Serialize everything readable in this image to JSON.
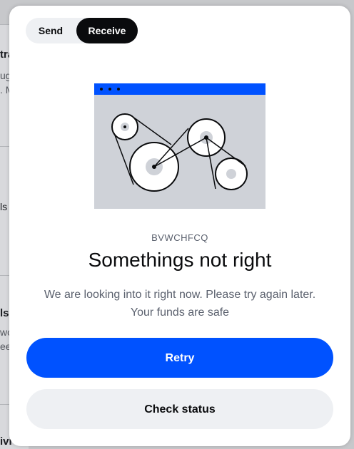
{
  "background": {
    "fragments": [
      "tra",
      "ug",
      ". M",
      "ls",
      "ls",
      "wo",
      "ee",
      "ivi"
    ]
  },
  "modal": {
    "toggle": {
      "options": [
        {
          "label": "Send",
          "selected": false
        },
        {
          "label": "Receive",
          "selected": true
        }
      ]
    },
    "illustration": {
      "name": "broken-gears-illustration",
      "header_color": "#0052ff",
      "body_color": "#cfd2d8"
    },
    "error_code": "BVWCHFCQ",
    "title": "Somethings not right",
    "message_line1": "We are looking into it right now. Please try again later.",
    "message_line2": "Your funds are safe",
    "retry_label": "Retry",
    "check_status_label": "Check status"
  },
  "colors": {
    "primary": "#0052ff",
    "text": "#0a0b0d",
    "muted_text": "#5b616e",
    "secondary_bg": "#eef0f3"
  }
}
